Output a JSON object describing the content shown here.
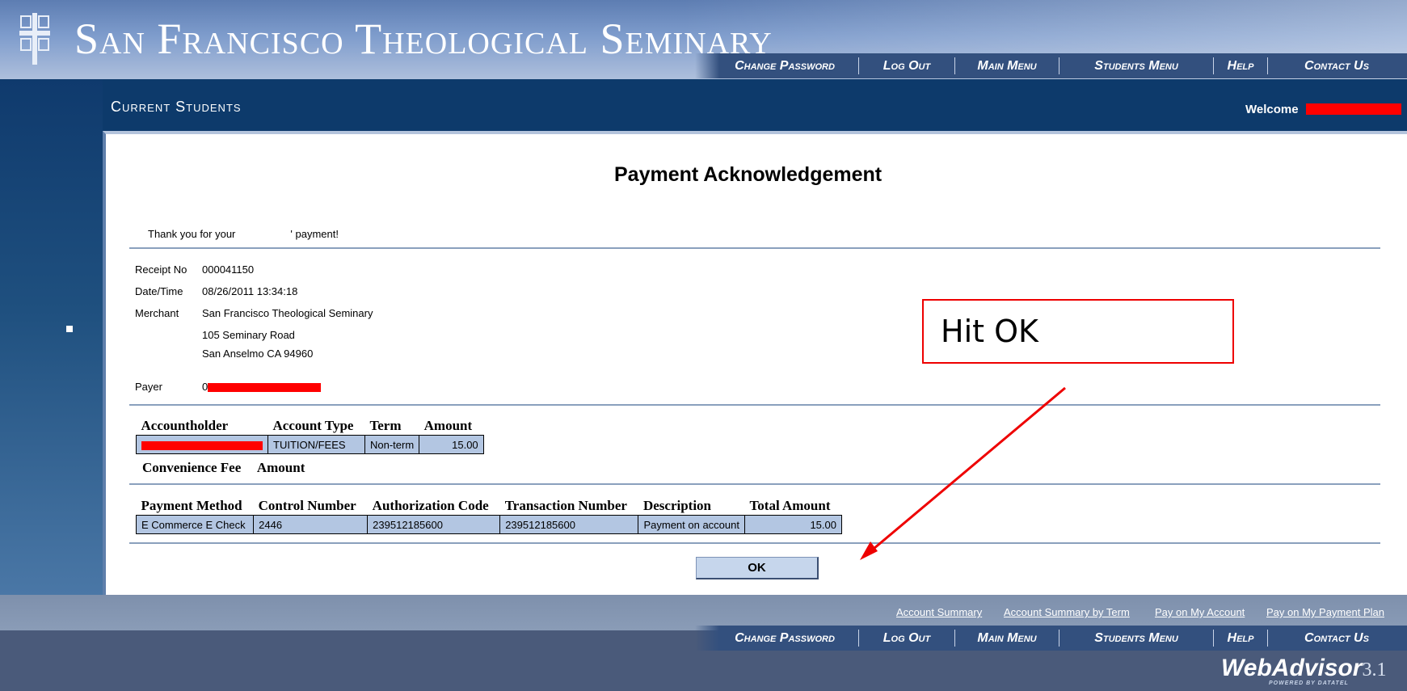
{
  "header": {
    "site_title": "San Francisco Theological Seminary",
    "nav": [
      "Change Password",
      "Log Out",
      "Main Menu",
      "Students Menu",
      "Help",
      "Contact Us"
    ]
  },
  "band": {
    "title": "Current Students",
    "welcome_label": "Welcome"
  },
  "page": {
    "title": "Payment Acknowledgement",
    "thanks_prefix": "Thank you for your",
    "thanks_suffix": "' payment!",
    "receipt": {
      "receipt_no_label": "Receipt No",
      "receipt_no": "000041150",
      "datetime_label": "Date/Time",
      "datetime": "08/26/2011 13:34:18",
      "merchant_label": "Merchant",
      "merchant_name": "San Francisco Theological Seminary",
      "merchant_address1": "105 Seminary Road",
      "merchant_address2": "San Anselmo CA 94960",
      "payer_label": "Payer",
      "payer_prefix": "0"
    },
    "account_table": {
      "headers": [
        "Accountholder",
        "Account Type",
        "Term",
        "Amount"
      ],
      "row": {
        "account_type": "TUITION/FEES",
        "term": "Non-term",
        "amount": "15.00"
      }
    },
    "fee_headers": [
      "Convenience Fee",
      "Amount"
    ],
    "payment_table": {
      "headers": [
        "Payment Method",
        "Control Number",
        "Authorization Code",
        "Transaction Number",
        "Description",
        "Total Amount"
      ],
      "row": [
        "E Commerce E Check",
        "2446",
        "239512185600",
        "239512185600",
        "Payment on account",
        "15.00"
      ]
    },
    "ok_label": "OK"
  },
  "annotation": {
    "callout_text": "Hit OK",
    "color": "#e00000"
  },
  "footer": {
    "links": [
      "Account Summary",
      "Account Summary by Term",
      "Pay on My Account",
      "Pay on My Payment Plan"
    ],
    "nav": [
      "Change Password",
      "Log Out",
      "Main Menu",
      "Students Menu",
      "Help",
      "Contact Us"
    ],
    "brand": "WebAdvisor",
    "version": "3.1",
    "powered_by": "POWERED BY DATATEL"
  },
  "colors": {
    "header_blue": "#5d7db2",
    "band_navy": "#0d3a6b",
    "table_cell": "#b3c6e2",
    "redaction": "#ff0000"
  },
  "icons": [
    "seminary-logo-icon",
    "bullet-icon",
    "annotation-arrow-icon"
  ]
}
